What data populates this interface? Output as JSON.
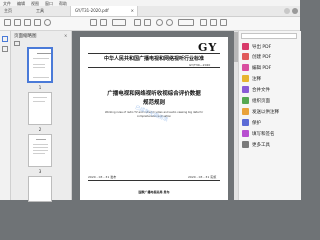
{
  "menubar": {
    "items": [
      "文件",
      "编辑",
      "视图",
      "窗口",
      "帮助"
    ]
  },
  "tab": {
    "title": "GY/T31-2020.pdf",
    "close": "×"
  },
  "nav": {
    "home": "主页",
    "tools": "工具"
  },
  "thumbnails": {
    "panel_title": "页面缩略图",
    "pages": [
      "1",
      "2",
      "3"
    ]
  },
  "document": {
    "logo": "GY",
    "header": "中华人民共和国广播电视和网络视听行业标准",
    "std_no": "GY/T30—2020",
    "title_line1": "广播电视和网络视听收视综合评价数据",
    "title_line2": "规范规则",
    "subtitle_line1": "Working rules of radio TV and network video and audio viewing big data for",
    "subtitle_line2": "comprehensive evaluation",
    "date_left": "2020 - 03 - 31 发布",
    "date_right": "2020 - 03 - 31 实施",
    "issuer": "国家广播电视总局 发布",
    "watermark": "已成年无偿阅读"
  },
  "right_panel": {
    "items": [
      {
        "label": "导出 PDF",
        "icon": "export-pdf-icon",
        "color": "#d83b6a"
      },
      {
        "label": "创建 PDF",
        "icon": "create-pdf-icon",
        "color": "#e05a5a"
      },
      {
        "label": "编辑 PDF",
        "icon": "edit-pdf-icon",
        "color": "#d94fa0"
      },
      {
        "label": "注释",
        "icon": "comment-icon",
        "color": "#e7b52f"
      },
      {
        "label": "合并文件",
        "icon": "combine-files-icon",
        "color": "#8a5bd6"
      },
      {
        "label": "组织页面",
        "icon": "organize-pages-icon",
        "color": "#56a852"
      },
      {
        "label": "发送以供注释",
        "icon": "send-for-comments-icon",
        "color": "#e9a23b"
      },
      {
        "label": "保护",
        "icon": "protect-icon",
        "color": "#5b6bd6"
      },
      {
        "label": "填写和签名",
        "icon": "fill-sign-icon",
        "color": "#b84fd0"
      },
      {
        "label": "更多工具",
        "icon": "more-tools-icon",
        "color": "#7a7a7a"
      }
    ]
  }
}
